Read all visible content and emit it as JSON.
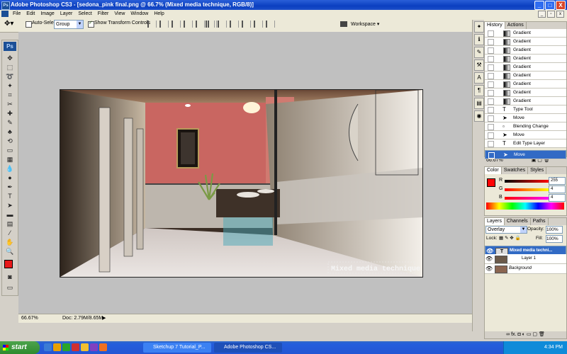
{
  "app": {
    "title": "Adobe Photoshop CS3 - [sedona_pink final.png @ 66.7% (Mixed media technique, RGB/8)]",
    "logo": "Ps"
  },
  "window_buttons": [
    "_",
    "□",
    "X"
  ],
  "menu": [
    "File",
    "Edit",
    "Image",
    "Layer",
    "Select",
    "Filter",
    "View",
    "Window",
    "Help"
  ],
  "options": {
    "auto_select_label": "Auto-Select:",
    "auto_select_value": "Group",
    "transform_label": "Show Transform Controls",
    "workspace_label": "Workspace"
  },
  "canvas": {
    "watermark_text": "Mixed media technique",
    "colors": {
      "wall": "#c96661",
      "floor": "#d8d3cf",
      "accent": "#4aa8b8"
    }
  },
  "status": {
    "zoom": "66.67%",
    "doc": "Doc: 2.79M/8.65M"
  },
  "history": {
    "tabs": [
      "History",
      "Actions"
    ],
    "items": [
      {
        "label": "Gradient",
        "icon": "gradient-icon"
      },
      {
        "label": "Gradient",
        "icon": "gradient-icon"
      },
      {
        "label": "Gradient",
        "icon": "gradient-icon"
      },
      {
        "label": "Gradient",
        "icon": "gradient-icon"
      },
      {
        "label": "Gradient",
        "icon": "gradient-icon"
      },
      {
        "label": "Gradient",
        "icon": "gradient-icon"
      },
      {
        "label": "Gradient",
        "icon": "gradient-icon"
      },
      {
        "label": "Gradient",
        "icon": "gradient-icon"
      },
      {
        "label": "Gradient",
        "icon": "gradient-icon"
      },
      {
        "label": "Type Tool",
        "icon": "type-icon"
      },
      {
        "label": "Move",
        "icon": "move-icon"
      },
      {
        "label": "Blending Change",
        "icon": "blend-icon"
      },
      {
        "label": "Move",
        "icon": "move-icon"
      },
      {
        "label": "Edit Type Layer",
        "icon": "type-icon"
      },
      {
        "label": "Move",
        "icon": "move-icon",
        "selected": true
      }
    ],
    "footer_zoom": "66.67%"
  },
  "color_panel": {
    "tabs": [
      "Color",
      "Swatches",
      "Styles"
    ],
    "r": {
      "label": "R",
      "value": "255"
    },
    "g": {
      "label": "G",
      "value": "4"
    },
    "b": {
      "label": "B",
      "value": "4"
    },
    "fg_color": "#ff0404"
  },
  "layers_panel": {
    "tabs": [
      "Layers",
      "Channels",
      "Paths"
    ],
    "blend_mode": "Overlay",
    "opacity_label": "Opacity:",
    "opacity": "100%",
    "fill_label": "Fill:",
    "fill": "100%",
    "lock_label": "Lock:",
    "layers": [
      {
        "name": "Mixed media techni...",
        "thumb": "T",
        "selected": true
      },
      {
        "name": "Layer 1",
        "thumb": "",
        "selected": false
      },
      {
        "name": "Background",
        "thumb": "",
        "selected": false,
        "italic": true
      }
    ]
  },
  "taskbar": {
    "start": "start",
    "tasks": [
      "Sketchup 7 Tutorial_P...",
      "Adobe Photoshop CS..."
    ],
    "time": "4:34 PM"
  }
}
